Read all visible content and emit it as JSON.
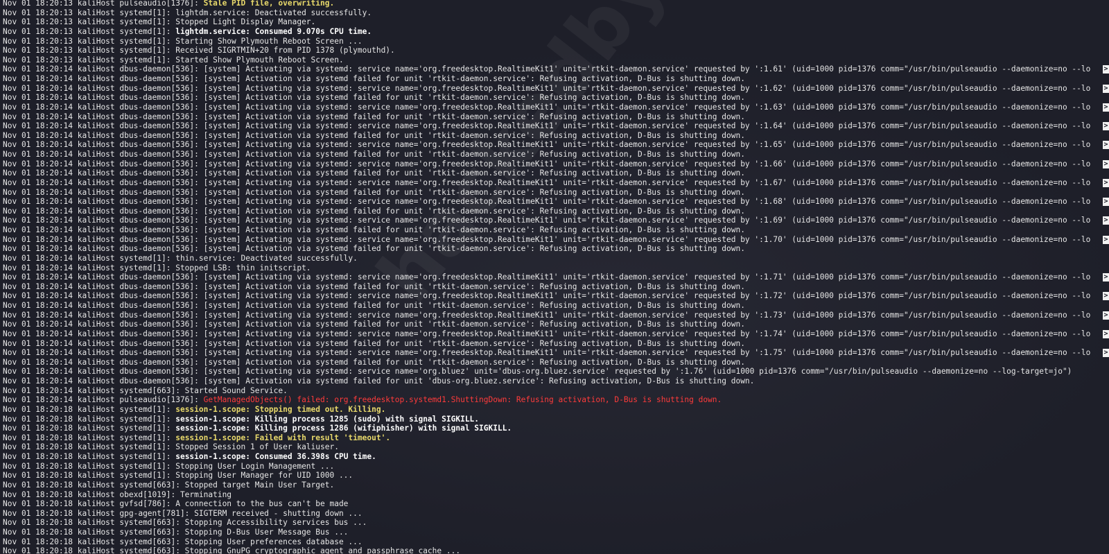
{
  "terminal": {
    "watermark": "hackedbyjax",
    "lines": [
      [
        {
          "t": "Nov 01 18:20:13 kaliHost pulseaudio[1376]: "
        },
        {
          "t": "Stale PID file, overwriting.",
          "s": "yellow"
        }
      ],
      [
        {
          "t": "Nov 01 18:20:13 kaliHost systemd[1]: lightdm.service: Deactivated successfully."
        }
      ],
      [
        {
          "t": "Nov 01 18:20:13 kaliHost systemd[1]: Stopped Light Display Manager."
        }
      ],
      [
        {
          "t": "Nov 01 18:20:13 kaliHost systemd[1]: "
        },
        {
          "t": "lightdm.service: Consumed 9.070s CPU time.",
          "s": "bold"
        }
      ],
      [
        {
          "t": "Nov 01 18:20:13 kaliHost systemd[1]: Starting Show Plymouth Reboot Screen ..."
        }
      ],
      [
        {
          "t": "Nov 01 18:20:13 kaliHost systemd[1]: Received SIGRTMIN+20 from PID 1378 (plymouthd)."
        }
      ],
      [
        {
          "t": "Nov 01 18:20:13 kaliHost systemd[1]: Started Show Plymouth Reboot Screen."
        }
      ],
      [
        {
          "t": "Nov 01 18:20:14 kaliHost dbus-daemon[536]: [system] Activating via systemd: service name='org.freedesktop.RealtimeKit1' unit='rtkit-daemon.service' requested by ':1.61' (uid=1000 pid=1376 comm=\"/usr/bin/pulseaudio --daemonize=no --lo"
        }
      ],
      [
        {
          "t": "Nov 01 18:20:14 kaliHost dbus-daemon[536]: [system] Activation via systemd failed for unit 'rtkit-daemon.service': Refusing activation, D-Bus is shutting down."
        }
      ],
      [
        {
          "t": "Nov 01 18:20:14 kaliHost dbus-daemon[536]: [system] Activating via systemd: service name='org.freedesktop.RealtimeKit1' unit='rtkit-daemon.service' requested by ':1.62' (uid=1000 pid=1376 comm=\"/usr/bin/pulseaudio --daemonize=no --lo"
        }
      ],
      [
        {
          "t": "Nov 01 18:20:14 kaliHost dbus-daemon[536]: [system] Activation via systemd failed for unit 'rtkit-daemon.service': Refusing activation, D-Bus is shutting down."
        }
      ],
      [
        {
          "t": "Nov 01 18:20:14 kaliHost dbus-daemon[536]: [system] Activating via systemd: service name='org.freedesktop.RealtimeKit1' unit='rtkit-daemon.service' requested by ':1.63' (uid=1000 pid=1376 comm=\"/usr/bin/pulseaudio --daemonize=no --lo"
        }
      ],
      [
        {
          "t": "Nov 01 18:20:14 kaliHost dbus-daemon[536]: [system] Activation via systemd failed for unit 'rtkit-daemon.service': Refusing activation, D-Bus is shutting down."
        }
      ],
      [
        {
          "t": "Nov 01 18:20:14 kaliHost dbus-daemon[536]: [system] Activating via systemd: service name='org.freedesktop.RealtimeKit1' unit='rtkit-daemon.service' requested by ':1.64' (uid=1000 pid=1376 comm=\"/usr/bin/pulseaudio --daemonize=no --lo"
        }
      ],
      [
        {
          "t": "Nov 01 18:20:14 kaliHost dbus-daemon[536]: [system] Activation via systemd failed for unit 'rtkit-daemon.service': Refusing activation, D-Bus is shutting down."
        }
      ],
      [
        {
          "t": "Nov 01 18:20:14 kaliHost dbus-daemon[536]: [system] Activating via systemd: service name='org.freedesktop.RealtimeKit1' unit='rtkit-daemon.service' requested by ':1.65' (uid=1000 pid=1376 comm=\"/usr/bin/pulseaudio --daemonize=no --lo"
        }
      ],
      [
        {
          "t": "Nov 01 18:20:14 kaliHost dbus-daemon[536]: [system] Activation via systemd failed for unit 'rtkit-daemon.service': Refusing activation, D-Bus is shutting down."
        }
      ],
      [
        {
          "t": "Nov 01 18:20:14 kaliHost dbus-daemon[536]: [system] Activating via systemd: service name='org.freedesktop.RealtimeKit1' unit='rtkit-daemon.service' requested by ':1.66' (uid=1000 pid=1376 comm=\"/usr/bin/pulseaudio --daemonize=no --lo"
        }
      ],
      [
        {
          "t": "Nov 01 18:20:14 kaliHost dbus-daemon[536]: [system] Activation via systemd failed for unit 'rtkit-daemon.service': Refusing activation, D-Bus is shutting down."
        }
      ],
      [
        {
          "t": "Nov 01 18:20:14 kaliHost dbus-daemon[536]: [system] Activating via systemd: service name='org.freedesktop.RealtimeKit1' unit='rtkit-daemon.service' requested by ':1.67' (uid=1000 pid=1376 comm=\"/usr/bin/pulseaudio --daemonize=no --lo"
        }
      ],
      [
        {
          "t": "Nov 01 18:20:14 kaliHost dbus-daemon[536]: [system] Activation via systemd failed for unit 'rtkit-daemon.service': Refusing activation, D-Bus is shutting down."
        }
      ],
      [
        {
          "t": "Nov 01 18:20:14 kaliHost dbus-daemon[536]: [system] Activating via systemd: service name='org.freedesktop.RealtimeKit1' unit='rtkit-daemon.service' requested by ':1.68' (uid=1000 pid=1376 comm=\"/usr/bin/pulseaudio --daemonize=no --lo"
        }
      ],
      [
        {
          "t": "Nov 01 18:20:14 kaliHost dbus-daemon[536]: [system] Activation via systemd failed for unit 'rtkit-daemon.service': Refusing activation, D-Bus is shutting down."
        }
      ],
      [
        {
          "t": "Nov 01 18:20:14 kaliHost dbus-daemon[536]: [system] Activating via systemd: service name='org.freedesktop.RealtimeKit1' unit='rtkit-daemon.service' requested by ':1.69' (uid=1000 pid=1376 comm=\"/usr/bin/pulseaudio --daemonize=no --lo"
        }
      ],
      [
        {
          "t": "Nov 01 18:20:14 kaliHost dbus-daemon[536]: [system] Activation via systemd failed for unit 'rtkit-daemon.service': Refusing activation, D-Bus is shutting down."
        }
      ],
      [
        {
          "t": "Nov 01 18:20:14 kaliHost dbus-daemon[536]: [system] Activating via systemd: service name='org.freedesktop.RealtimeKit1' unit='rtkit-daemon.service' requested by ':1.70' (uid=1000 pid=1376 comm=\"/usr/bin/pulseaudio --daemonize=no --lo"
        }
      ],
      [
        {
          "t": "Nov 01 18:20:14 kaliHost dbus-daemon[536]: [system] Activation via systemd failed for unit 'rtkit-daemon.service': Refusing activation, D-Bus is shutting down."
        }
      ],
      [
        {
          "t": "Nov 01 18:20:14 kaliHost systemd[1]: thin.service: Deactivated successfully."
        }
      ],
      [
        {
          "t": "Nov 01 18:20:14 kaliHost systemd[1]: Stopped LSB: thin initscript."
        }
      ],
      [
        {
          "t": "Nov 01 18:20:14 kaliHost dbus-daemon[536]: [system] Activating via systemd: service name='org.freedesktop.RealtimeKit1' unit='rtkit-daemon.service' requested by ':1.71' (uid=1000 pid=1376 comm=\"/usr/bin/pulseaudio --daemonize=no --lo"
        }
      ],
      [
        {
          "t": "Nov 01 18:20:14 kaliHost dbus-daemon[536]: [system] Activation via systemd failed for unit 'rtkit-daemon.service': Refusing activation, D-Bus is shutting down."
        }
      ],
      [
        {
          "t": "Nov 01 18:20:14 kaliHost dbus-daemon[536]: [system] Activating via systemd: service name='org.freedesktop.RealtimeKit1' unit='rtkit-daemon.service' requested by ':1.72' (uid=1000 pid=1376 comm=\"/usr/bin/pulseaudio --daemonize=no --lo"
        }
      ],
      [
        {
          "t": "Nov 01 18:20:14 kaliHost dbus-daemon[536]: [system] Activation via systemd failed for unit 'rtkit-daemon.service': Refusing activation, D-Bus is shutting down."
        }
      ],
      [
        {
          "t": "Nov 01 18:20:14 kaliHost dbus-daemon[536]: [system] Activating via systemd: service name='org.freedesktop.RealtimeKit1' unit='rtkit-daemon.service' requested by ':1.73' (uid=1000 pid=1376 comm=\"/usr/bin/pulseaudio --daemonize=no --lo"
        }
      ],
      [
        {
          "t": "Nov 01 18:20:14 kaliHost dbus-daemon[536]: [system] Activation via systemd failed for unit 'rtkit-daemon.service': Refusing activation, D-Bus is shutting down."
        }
      ],
      [
        {
          "t": "Nov 01 18:20:14 kaliHost dbus-daemon[536]: [system] Activating via systemd: service name='org.freedesktop.RealtimeKit1' unit='rtkit-daemon.service' requested by ':1.74' (uid=1000 pid=1376 comm=\"/usr/bin/pulseaudio --daemonize=no --lo"
        }
      ],
      [
        {
          "t": "Nov 01 18:20:14 kaliHost dbus-daemon[536]: [system] Activation via systemd failed for unit 'rtkit-daemon.service': Refusing activation, D-Bus is shutting down."
        }
      ],
      [
        {
          "t": "Nov 01 18:20:14 kaliHost dbus-daemon[536]: [system] Activating via systemd: service name='org.freedesktop.RealtimeKit1' unit='rtkit-daemon.service' requested by ':1.75' (uid=1000 pid=1376 comm=\"/usr/bin/pulseaudio --daemonize=no --lo"
        }
      ],
      [
        {
          "t": "Nov 01 18:20:14 kaliHost dbus-daemon[536]: [system] Activation via systemd failed for unit 'rtkit-daemon.service': Refusing activation, D-Bus is shutting down."
        }
      ],
      [
        {
          "t": "Nov 01 18:20:14 kaliHost dbus-daemon[536]: [system] Activating via systemd: service name='org.bluez' unit='dbus-org.bluez.service' requested by ':1.76' (uid=1000 pid=1376 comm=\"/usr/bin/pulseaudio --daemonize=no --log-target=jo\")"
        }
      ],
      [
        {
          "t": "Nov 01 18:20:14 kaliHost dbus-daemon[536]: [system] Activation via systemd failed for unit 'dbus-org.bluez.service': Refusing activation, D-Bus is shutting down."
        }
      ],
      [
        {
          "t": "Nov 01 18:20:14 kaliHost systemd[663]: Started Sound Service."
        }
      ],
      [
        {
          "t": "Nov 01 18:20:14 kaliHost pulseaudio[1376]: "
        },
        {
          "t": "GetManagedObjects() failed: org.freedesktop.systemd1.ShuttingDown: Refusing activation, D-Bus is shutting down.",
          "s": "red"
        }
      ],
      [
        {
          "t": "Nov 01 18:20:18 kaliHost systemd[1]: "
        },
        {
          "t": "session-1.scope: Stopping timed out. Killing.",
          "s": "yellow"
        }
      ],
      [
        {
          "t": "Nov 01 18:20:18 kaliHost systemd[1]: "
        },
        {
          "t": "session-1.scope: Killing process 1285 (sudo) with signal SIGKILL.",
          "s": "bold"
        }
      ],
      [
        {
          "t": "Nov 01 18:20:18 kaliHost systemd[1]: "
        },
        {
          "t": "session-1.scope: Killing process 1286 (wifiphisher) with signal SIGKILL.",
          "s": "bold"
        }
      ],
      [
        {
          "t": "Nov 01 18:20:18 kaliHost systemd[1]: "
        },
        {
          "t": "session-1.scope: Failed with result 'timeout'.",
          "s": "yellow"
        }
      ],
      [
        {
          "t": "Nov 01 18:20:18 kaliHost systemd[1]: Stopped Session 1 of User kaliuser."
        }
      ],
      [
        {
          "t": "Nov 01 18:20:18 kaliHost systemd[1]: "
        },
        {
          "t": "session-1.scope: Consumed 36.398s CPU time.",
          "s": "bold"
        }
      ],
      [
        {
          "t": "Nov 01 18:20:18 kaliHost systemd[1]: Stopping User Login Management ..."
        }
      ],
      [
        {
          "t": "Nov 01 18:20:18 kaliHost systemd[1]: Stopping User Manager for UID 1000 ..."
        }
      ],
      [
        {
          "t": "Nov 01 18:20:18 kaliHost systemd[663]: Stopped target Main User Target."
        }
      ],
      [
        {
          "t": "Nov 01 18:20:18 kaliHost obexd[1019]: Terminating"
        }
      ],
      [
        {
          "t": "Nov 01 18:20:18 kaliHost gvfsd[786]: A connection to the bus can't be made"
        }
      ],
      [
        {
          "t": "Nov 01 18:20:18 kaliHost gpg-agent[781]: SIGTERM received - shutting down ..."
        }
      ],
      [
        {
          "t": "Nov 01 18:20:18 kaliHost systemd[663]: Stopping Accessibility services bus ..."
        }
      ],
      [
        {
          "t": "Nov 01 18:20:18 kaliHost systemd[663]: Stopping D-Bus User Message Bus ..."
        }
      ],
      [
        {
          "t": "Nov 01 18:20:18 kaliHost systemd[663]: Stopping User preferences database ..."
        }
      ],
      [
        {
          "t": "Nov 01 18:20:18 kaliHost systemd[663]: Stopping GnuPG cryptographic agent and passphrase cache ..."
        }
      ]
    ],
    "truncation_marker": ">",
    "truncated_line_indices": [
      7,
      9,
      11,
      13,
      15,
      17,
      19,
      21,
      23,
      25,
      29,
      31,
      33,
      35,
      37
    ]
  }
}
